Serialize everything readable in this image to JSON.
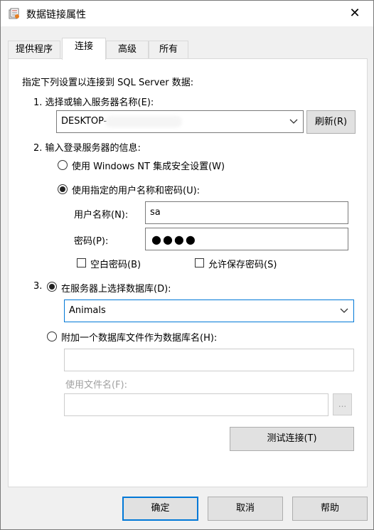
{
  "window": {
    "title": "数据链接属性",
    "close": "✕"
  },
  "tabs": [
    {
      "label": "提供程序"
    },
    {
      "label": "连接"
    },
    {
      "label": "高级"
    },
    {
      "label": "所有"
    }
  ],
  "connection": {
    "intro": "指定下列设置以连接到 SQL Server 数据:",
    "step1_label": "1. 选择或输入服务器名称(E):",
    "server_value": "DESKTOP-",
    "refresh_button": "刷新(R)",
    "step2_label": "2. 输入登录服务器的信息:",
    "radio_nt": "使用 Windows NT 集成安全设置(W)",
    "radio_user": "使用指定的用户名称和密码(U):",
    "username_label": "用户名称(N):",
    "username_value": "sa",
    "password_label": "密码(P):",
    "password_value": "●●●●",
    "blank_password": "空白密码(B)",
    "allow_save_password": "允许保存密码(S)",
    "step3_label": "3.",
    "radio_select_db": "在服务器上选择数据库(D):",
    "database_value": "Animals",
    "radio_attach_db": "附加一个数据库文件作为数据库名(H):",
    "use_filename_label": "使用文件名(F):",
    "browse_button": "...",
    "test_button": "测试连接(T)"
  },
  "footer": {
    "ok": "确定",
    "cancel": "取消",
    "help": "帮助"
  },
  "colors": {
    "accent": "#0078d7",
    "panel": "#ffffff",
    "background": "#f0f0f0"
  }
}
